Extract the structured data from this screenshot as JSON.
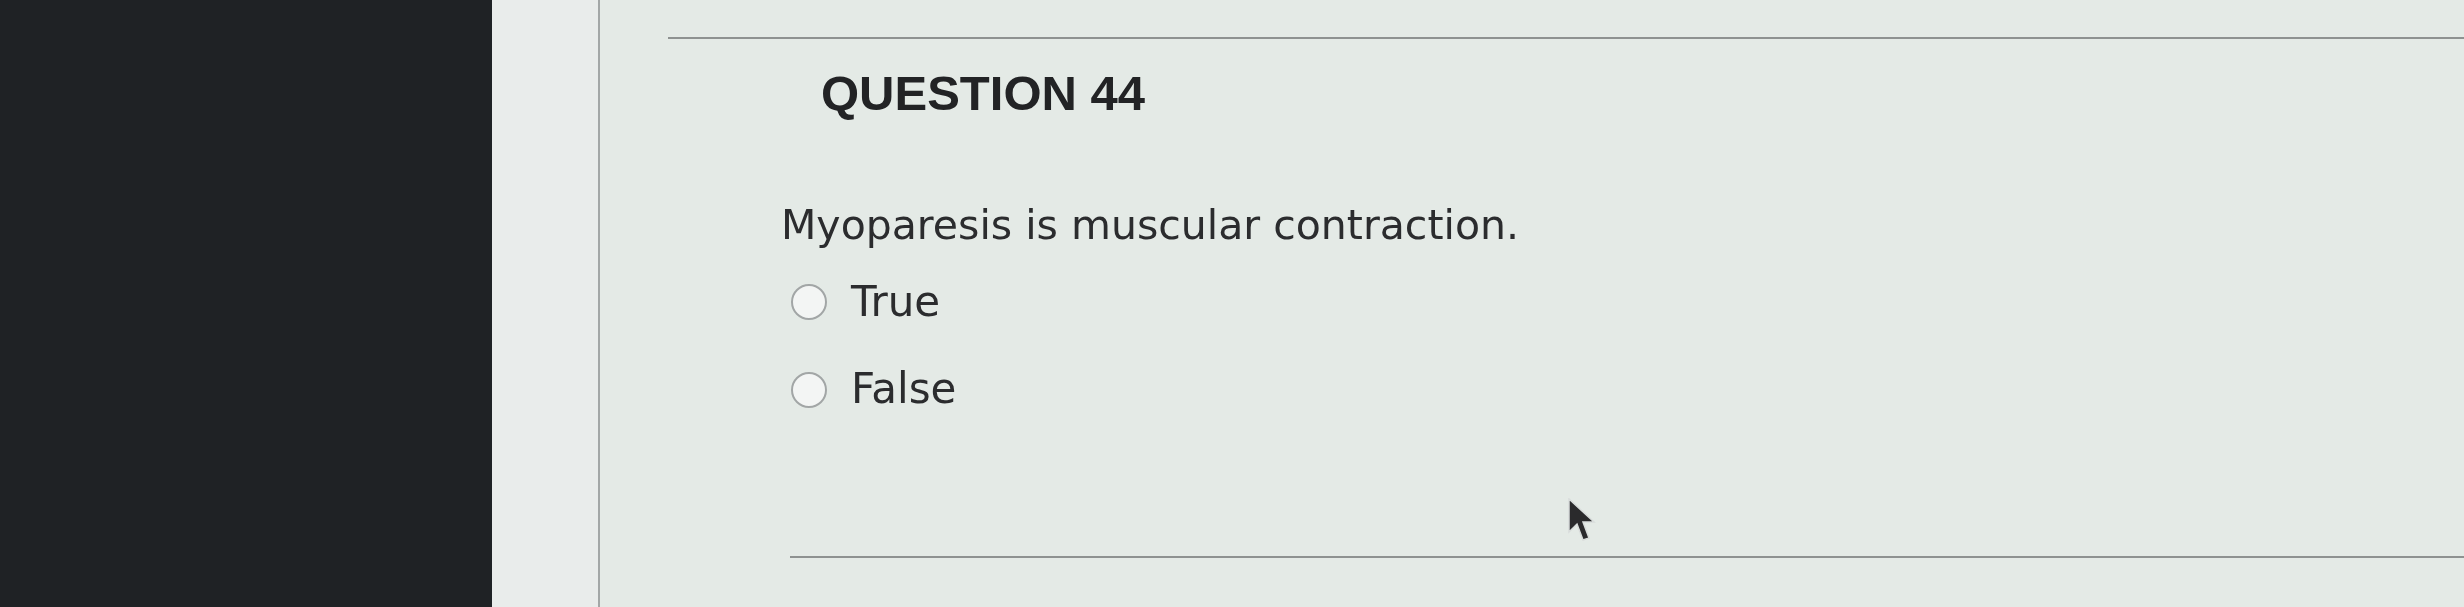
{
  "question": {
    "title": "QUESTION 44",
    "text": "Myoparesis is muscular contraction.",
    "options": [
      {
        "label": "True",
        "selected": false
      },
      {
        "label": "False",
        "selected": false
      }
    ]
  }
}
